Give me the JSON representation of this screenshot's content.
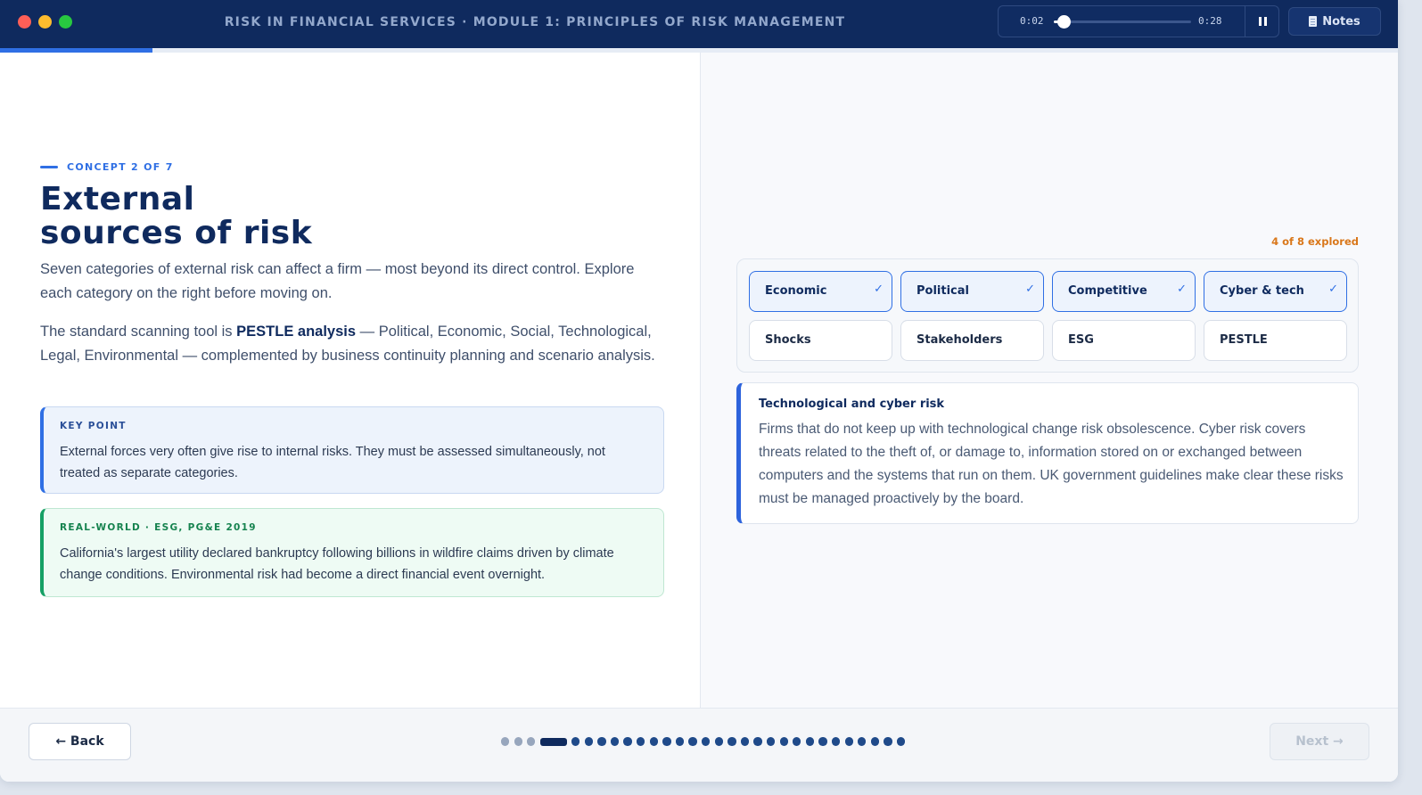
{
  "window": {
    "course_title": "RISK IN FINANCIAL SERVICES · MODULE 1: PRINCIPLES OF RISK MANAGEMENT"
  },
  "player": {
    "current_time": "0:02",
    "total_time": "0:28",
    "progress_fraction": 0.07,
    "pause_icon": "pause-icon"
  },
  "notes": {
    "label": "Notes",
    "icon": "notes-icon"
  },
  "course_progress_fraction": 0.109,
  "concept": {
    "eyebrow": "CONCEPT 2 OF 7",
    "title_line1": "External",
    "title_line2": "sources of risk",
    "para1": "Seven categories of external risk can affect a firm — most beyond its direct control. Explore each category on the right before moving on.",
    "para2_before": "The standard scanning tool is ",
    "para2_bold": "PESTLE analysis",
    "para2_after": " — Political, Economic, Social, Technological, Legal, Environmental — complemented by business continuity planning and scenario analysis."
  },
  "key_point": {
    "label": "KEY POINT",
    "text": "External forces very often give rise to internal risks. They must be assessed simultaneously, not treated as separate categories."
  },
  "real_world": {
    "label": "REAL-WORLD · ESG, PG&E 2019",
    "text": "California's largest utility declared bankruptcy following billions in wildfire claims driven by climate change conditions. Environmental risk had become a direct financial event overnight."
  },
  "explorer": {
    "status": "4 of 8 explored",
    "check_glyph": "✓",
    "chips": [
      {
        "label": "Economic",
        "explored": true
      },
      {
        "label": "Political",
        "explored": true
      },
      {
        "label": "Competitive",
        "explored": true
      },
      {
        "label": "Cyber & tech",
        "explored": true
      },
      {
        "label": "Shocks",
        "explored": false
      },
      {
        "label": "Stakeholders",
        "explored": false
      },
      {
        "label": "ESG",
        "explored": false
      },
      {
        "label": "PESTLE",
        "explored": false
      }
    ],
    "detail": {
      "title": "Technological and cyber risk",
      "body": "Firms that do not keep up with technological change risk obsolescence. Cyber risk covers threats related to the theft of, or damage to, information stored on or exchanged between computers and the systems that run on them. UK government guidelines make clear these risks must be managed proactively by the board."
    }
  },
  "footer": {
    "back_label": "← Back",
    "next_label": "Next →",
    "total_steps": 30,
    "current_step": 4,
    "visited_steps": 3
  },
  "colors": {
    "navy": "#0f2a5e",
    "accent_blue": "#2f6fe4",
    "accent_green": "#16a065",
    "accent_orange": "#d9771a"
  }
}
